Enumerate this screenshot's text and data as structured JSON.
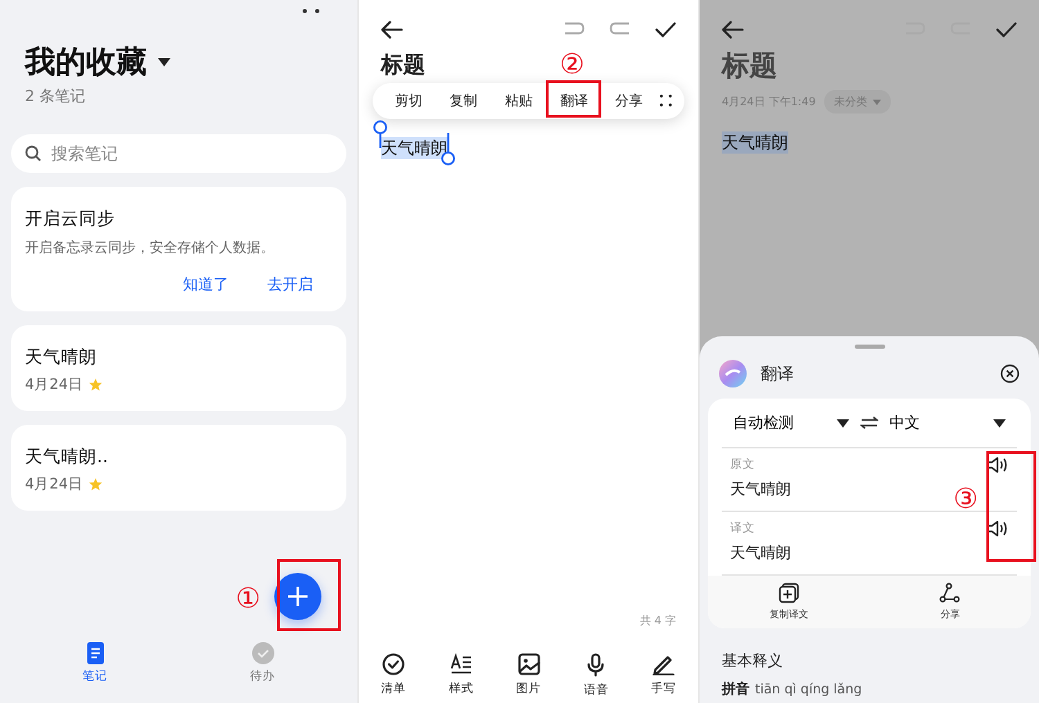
{
  "screens": [
    {
      "kind": "list",
      "title": "我的收藏",
      "subtitle": "2 条笔记",
      "search": {
        "placeholder": "搜索笔记"
      },
      "sync_card": {
        "title": "开启云同步",
        "text": "开启备忘录云同步，安全存储个人数据。",
        "actions": [
          "知道了",
          "去开启"
        ]
      },
      "notes": [
        {
          "title": "天气晴朗",
          "date": "4月24日",
          "starred": true
        },
        {
          "title": "天气晴朗..",
          "date": "4月24日",
          "starred": true
        }
      ],
      "fab_annotation": "①",
      "bottom_tabs": [
        {
          "label": "笔记",
          "kind": "notes",
          "selected": true
        },
        {
          "label": "待办",
          "kind": "todo",
          "selected": false
        }
      ]
    },
    {
      "kind": "editor",
      "title": "标题",
      "body": "天气晴朗",
      "body_selected": true,
      "context_menu": [
        {
          "label": "剪切",
          "annotated": false
        },
        {
          "label": "复制",
          "annotated": false
        },
        {
          "label": "粘贴",
          "annotated": false
        },
        {
          "label": "翻译",
          "annotated": true
        },
        {
          "label": "分享",
          "annotated": false
        }
      ],
      "menu_annotation": "②",
      "char_count": "共 4 字",
      "toolbar": [
        {
          "label": "清单",
          "kind": "checklist"
        },
        {
          "label": "样式",
          "kind": "style"
        },
        {
          "label": "图片",
          "kind": "image"
        },
        {
          "label": "语音",
          "kind": "voice"
        },
        {
          "label": "手写",
          "kind": "handwriting"
        }
      ]
    },
    {
      "kind": "translate",
      "title": "标题",
      "meta": "4月24日 下午1:49",
      "category": "未分类",
      "body": "天气晴朗",
      "body_selected": true,
      "sheet": {
        "title": "翻译",
        "source_lang": "自动检测",
        "target_lang": "中文",
        "original_label": "原文",
        "original": "天气晴朗",
        "translated_label": "译文",
        "translated": "天气晴朗",
        "speaker_annotation": "③",
        "actions": [
          {
            "label": "复制译文",
            "kind": "copy"
          },
          {
            "label": "分享",
            "kind": "share"
          }
        ],
        "section_title": "基本释义",
        "pinyin_label": "拼音",
        "pinyin": "tiān qì qíng lǎng"
      }
    }
  ]
}
